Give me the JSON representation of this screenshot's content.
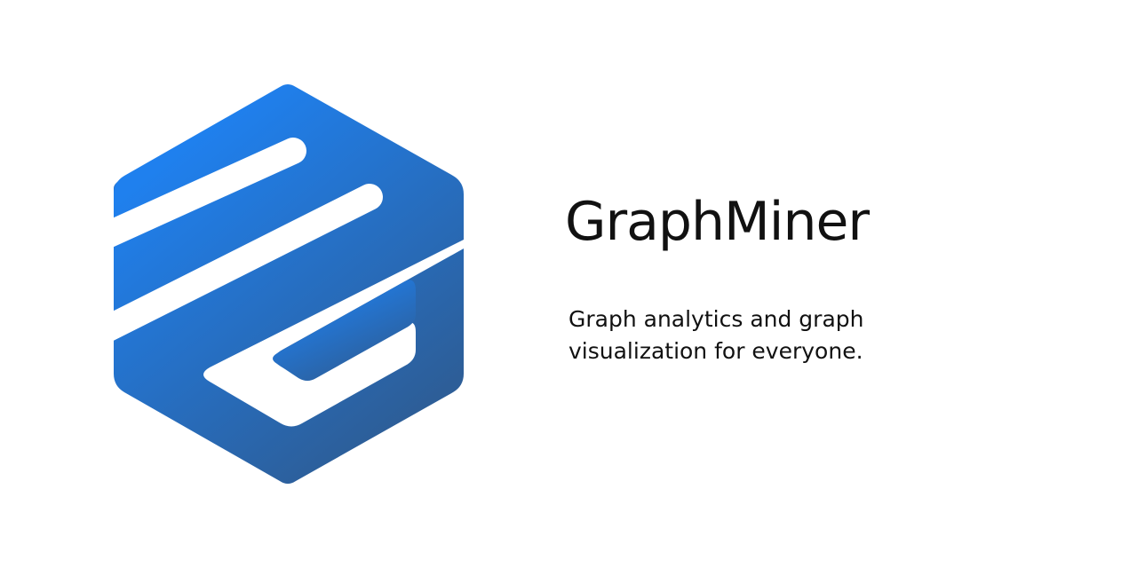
{
  "brand": {
    "name": "GraphMiner",
    "tagline_lines": [
      "Graph analytics and graph",
      "visualization for everyone."
    ],
    "logo_icon": "hexagon-g-logo-icon",
    "colors": {
      "logo_gradient_start": "#1f80ee",
      "logo_gradient_end": "#2d5e98",
      "text": "#111111",
      "background": "#ffffff"
    }
  }
}
